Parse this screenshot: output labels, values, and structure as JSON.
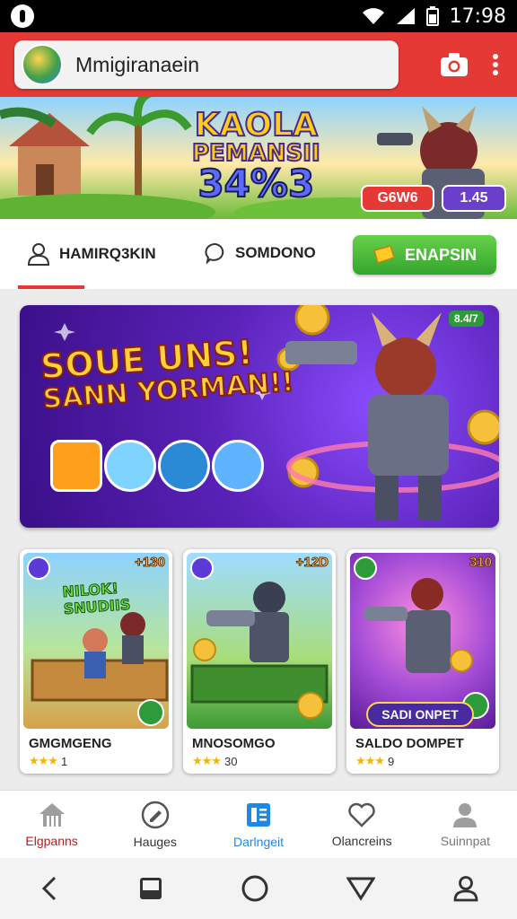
{
  "status_bar": {
    "time": "17:98"
  },
  "app_bar": {
    "title": "Mmigiranaein"
  },
  "hero": {
    "title_line1": "KAOLA",
    "title_line2": "PEMANSII",
    "title_line3": "34%3",
    "pill_red": "G6W6",
    "pill_purple": "1.45"
  },
  "tabs": {
    "tab1_label": "HAMIRQ3KIN",
    "tab2_label": "SOMDONO",
    "action_button": "ENAPSIN"
  },
  "promo": {
    "line1": "SOUE UNS!",
    "line2": "SANN YORMAN!!",
    "badge": "8.4/7"
  },
  "cards": [
    {
      "title": "GMGMGENG",
      "rating_text": "1",
      "price": "+130",
      "art_text": "NILOK! SNUDIIS"
    },
    {
      "title": "MNOSOMGO",
      "rating_text": "30",
      "price": "+12D"
    },
    {
      "title": "SALDO DOMPET",
      "rating_text": "9",
      "price": "310",
      "banner": "SADI ONPET"
    }
  ],
  "bottom_nav": [
    {
      "label": "Elgpanns",
      "icon": "home-icon"
    },
    {
      "label": "Hauges",
      "icon": "edit-icon"
    },
    {
      "label": "Darlngeit",
      "icon": "book-icon"
    },
    {
      "label": "Olancreins",
      "icon": "heart-icon"
    },
    {
      "label": "Suinnpat",
      "icon": "person-icon"
    }
  ],
  "colors": {
    "app_bar": "#e53935",
    "accent_green": "#34a52c",
    "active_nav": "#1e88e5"
  }
}
